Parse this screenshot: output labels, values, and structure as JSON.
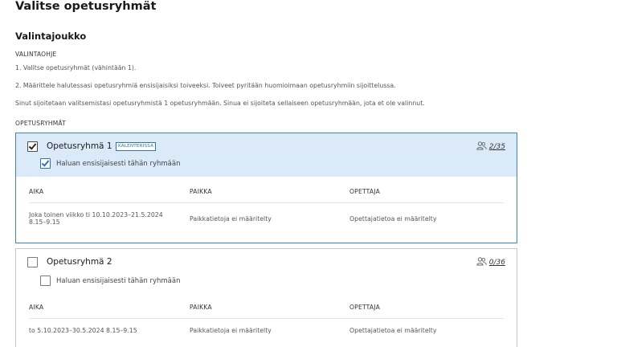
{
  "page": {
    "title": "Valitse opetusryhmät",
    "section_title": "Valintajoukko",
    "instructions_label": "VALINTAOHJE",
    "instructions": [
      "1. Valitse opetusryhmät (vähintään 1).",
      "2. Määrittele halutessasi opetusryhmiä ensisijaisiksi toiveeksi. Toiveet pyritään huomioimaan opetusryhmiin sijoittelussa.",
      "Sinut sijoitetaan valitsemistasi opetusryhmistä 1 opetusryhmään. Sinua ei sijoiteta sellaiseen opetusryhmään, jota et ole valinnut."
    ],
    "groups_label": "OPETUSRYHMÄT"
  },
  "groups": [
    {
      "name": "Opetusryhmä 1",
      "badge": "KALENTERISSA",
      "selected": true,
      "priority_label": "Haluan ensisijaisesti tähän ryhmään",
      "priority_checked": true,
      "seats": "2/35",
      "columns": [
        "AIKA",
        "PAIKKA",
        "OPETTAJA"
      ],
      "row": {
        "time": "Joka toinen viikko ti 10.10.2023–21.5.2024 8.15–9.15",
        "place": "Paikkatietoja ei määritelty",
        "teacher": "Opettajatietoa ei määritelty"
      }
    },
    {
      "name": "Opetusryhmä 2",
      "badge": "",
      "selected": false,
      "priority_label": "Haluan ensisijaisesti tähän ryhmään",
      "priority_checked": false,
      "seats": "0/36",
      "columns": [
        "AIKA",
        "PAIKKA",
        "OPETTAJA"
      ],
      "row": {
        "time": "to 5.10.2023–30.5.2024 8.15–9.15",
        "place": "Paikkatietoja ei määritelty",
        "teacher": "Opettajatietoa ei määritelty"
      }
    }
  ],
  "icons": {
    "seats": "people-icon",
    "checkbox": "checkmark-icon"
  },
  "colors": {
    "accent": "#2f74b8",
    "selected_bg": "#daeaf8",
    "selected_border": "#3a86c8"
  }
}
